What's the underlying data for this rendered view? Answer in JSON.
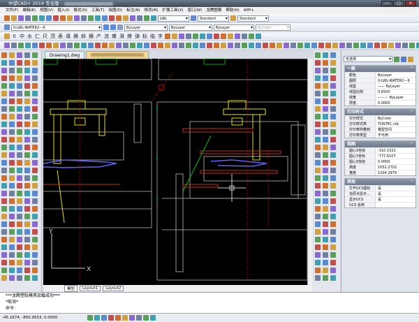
{
  "app": {
    "title": "中望CAD+ 2014 专业版 -"
  },
  "window_buttons": [
    "—",
    "□",
    "×"
  ],
  "menu": [
    "文件(F)",
    "编辑(E)",
    "视图(V)",
    "插入(I)",
    "格式(O)",
    "工具(T)",
    "绘图(D)",
    "标注(N)",
    "修改(M)",
    "扩展工具(X)",
    "窗口(W)",
    "龙腾塑模",
    "帮助(H)",
    "APP+"
  ],
  "toolbar1": {
    "dimstyle": "LWL",
    "textstyle": "Standard",
    "tablestyle": "Standard"
  },
  "toolbar2": {
    "layer": "0-LWL-WATER2---9",
    "color": "ByLayer",
    "linetype": "ByLayer",
    "lineweight": "ByLayer",
    "plotstyle": "ByColor"
  },
  "toolbar3": {
    "chars": [
      "0",
      "中",
      "水",
      "仁",
      "尺",
      "顶",
      "表",
      "填",
      "横",
      "斜",
      "横",
      "产",
      "流",
      "螺",
      "滑",
      "撑",
      "弹",
      "标",
      "临",
      "字"
    ]
  },
  "tabs": [
    {
      "label": "Drawing1.dwg",
      "active": false
    },
    {
      "label": "",
      "active": true
    }
  ],
  "layout_tabs": [
    "模型",
    "Layout1",
    "Layout2"
  ],
  "ucs": {
    "x": "X",
    "y": "Y"
  },
  "properties": {
    "selection": "无选择",
    "sections": [
      {
        "title": "一般",
        "rows": [
          [
            "颜色",
            "ByLayer"
          ],
          [
            "图层",
            "0-LWL-WATER2---9"
          ],
          [
            "线型",
            "—— ByLayer"
          ],
          [
            "线型比例",
            "0.6500"
          ],
          [
            "线宽",
            "——— ByLayer"
          ],
          [
            "厚度",
            "0.0000"
          ]
        ]
      },
      {
        "title": "打印样式",
        "rows": [
          [
            "打印样式",
            "ByColor"
          ],
          [
            "打印样式表",
            "TONTEC.ctb"
          ],
          [
            "打印表附着到",
            "模型空间"
          ],
          [
            "打印表类型",
            "不可用"
          ]
        ]
      },
      {
        "title": "视图",
        "rows": [
          [
            "圆心X坐标",
            "-310.1522"
          ],
          [
            "圆心Y坐标",
            "-777.6107"
          ],
          [
            "圆心Z坐标",
            "0.0000"
          ],
          [
            "高度",
            "1052.2702"
          ],
          [
            "宽度",
            "1204.2979"
          ]
        ]
      },
      {
        "title": "其他",
        "rows": [
          [
            "打开UCS图标",
            "是"
          ],
          [
            "在原点显示...",
            "是"
          ],
          [
            "显示UCS",
            "是"
          ],
          [
            "UCS 名称",
            ""
          ]
        ]
      }
    ]
  },
  "command": {
    "lines": [
      "***龙腾塑胶模具加载成功***",
      "*取消*"
    ],
    "prompt": "命令:"
  },
  "status": {
    "coords": "-45.1674,  -850.9553,  0.0000"
  },
  "colors": {
    "drawing_bg": "#000000",
    "yellow": "#e8e000",
    "green": "#00c000",
    "red": "#c00000",
    "blue": "#6060ff",
    "cyan": "#00d0d0"
  }
}
